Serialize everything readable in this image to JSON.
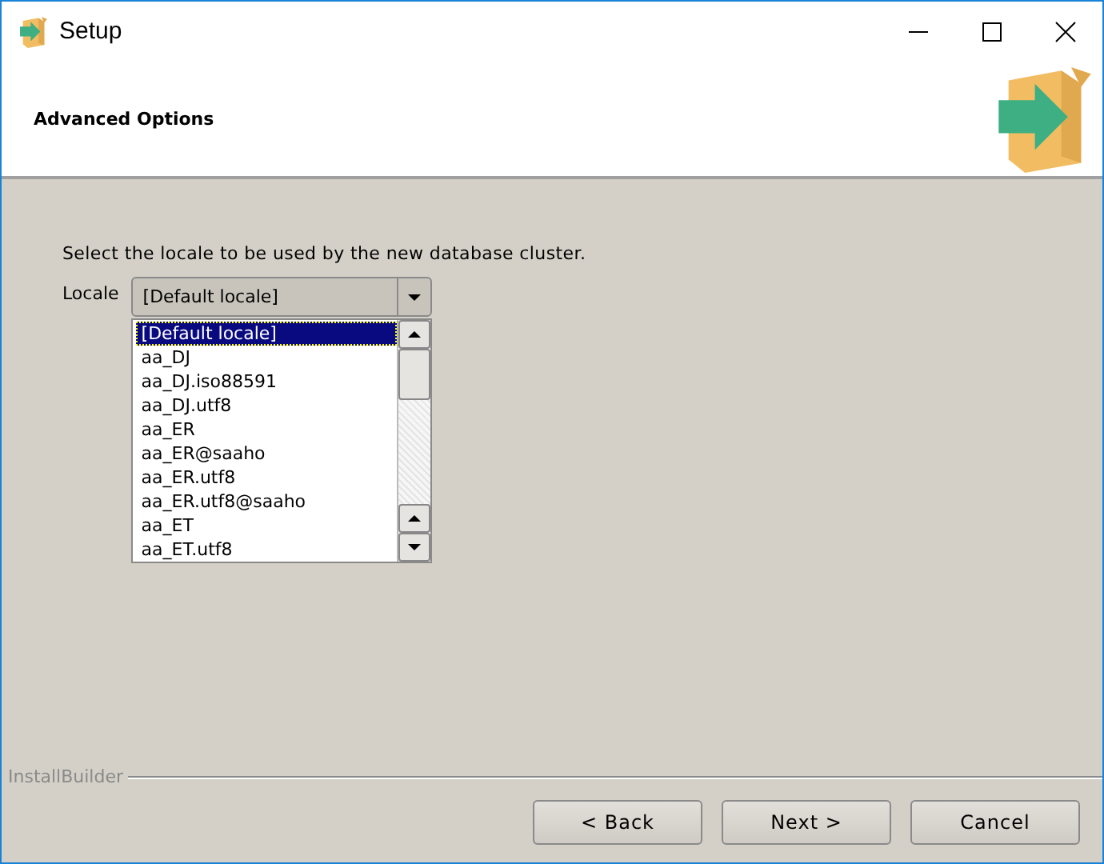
{
  "window": {
    "title": "Setup"
  },
  "header": {
    "title": "Advanced Options"
  },
  "prompt": "Select the locale to be used by the new database cluster.",
  "locale": {
    "label": "Locale",
    "value": "[Default locale]",
    "options": [
      {
        "label": "[Default locale]",
        "selected": true
      },
      {
        "label": "aa_DJ",
        "selected": false
      },
      {
        "label": "aa_DJ.iso88591",
        "selected": false
      },
      {
        "label": "aa_DJ.utf8",
        "selected": false
      },
      {
        "label": "aa_ER",
        "selected": false
      },
      {
        "label": "aa_ER@saaho",
        "selected": false
      },
      {
        "label": "aa_ER.utf8",
        "selected": false
      },
      {
        "label": "aa_ER.utf8@saaho",
        "selected": false
      },
      {
        "label": "aa_ET",
        "selected": false
      },
      {
        "label": "aa_ET.utf8",
        "selected": false
      }
    ]
  },
  "footer": {
    "brand": "InstallBuilder",
    "buttons": [
      "< Back",
      "Next >",
      "Cancel"
    ]
  }
}
